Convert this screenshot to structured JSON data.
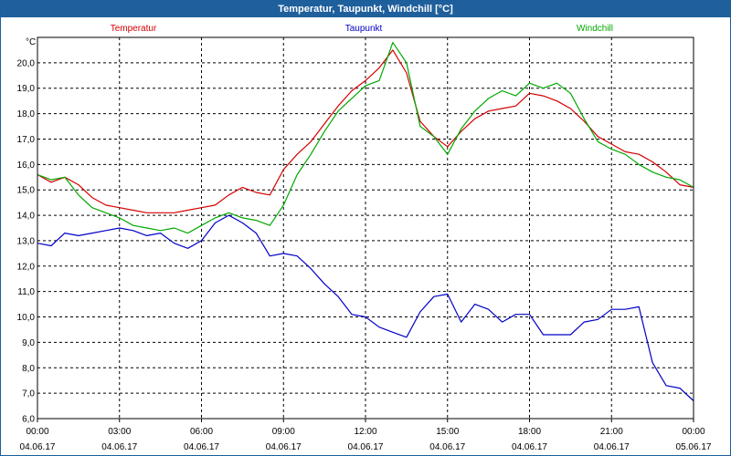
{
  "window": {
    "title": "Temperatur, Taupunkt, Windchill [°C]"
  },
  "colors": {
    "temperatur": "#d40000",
    "taupunkt": "#0000c8",
    "windchill": "#00a800",
    "grid": "#000000"
  },
  "chart_data": {
    "type": "line",
    "title": "Temperatur, Taupunkt, Windchill [°C]",
    "ylabel": "°C",
    "ylim": [
      6.0,
      21.0
    ],
    "y_ticks": [
      "6,0",
      "7,0",
      "8,0",
      "9,0",
      "10,0",
      "11,0",
      "12,0",
      "13,0",
      "14,0",
      "15,0",
      "16,0",
      "17,0",
      "18,0",
      "19,0",
      "20,0"
    ],
    "x_hours_range": [
      0,
      24
    ],
    "x_ticks": [
      {
        "time": "00:00",
        "date": "04.06.17"
      },
      {
        "time": "03:00",
        "date": "04.06.17"
      },
      {
        "time": "06:00",
        "date": "04.06.17"
      },
      {
        "time": "09:00",
        "date": "04.06.17"
      },
      {
        "time": "12:00",
        "date": "04.06.17"
      },
      {
        "time": "15:00",
        "date": "04.06.17"
      },
      {
        "time": "18:00",
        "date": "04.06.17"
      },
      {
        "time": "21:00",
        "date": "04.06.17"
      },
      {
        "time": "00:00",
        "date": "05.06.17"
      }
    ],
    "grid": true,
    "legend_placement": "top",
    "series": [
      {
        "name": "Temperatur",
        "color": "#d40000",
        "x": [
          0,
          0.5,
          1,
          1.5,
          2,
          2.5,
          3,
          3.5,
          4,
          4.5,
          5,
          5.5,
          6,
          6.5,
          7,
          7.5,
          8,
          8.5,
          9,
          9.5,
          10,
          10.5,
          11,
          11.5,
          12,
          12.5,
          13,
          13.5,
          14,
          14.5,
          15,
          15.5,
          16,
          16.5,
          17,
          17.5,
          18,
          18.5,
          19,
          19.5,
          20,
          20.5,
          21,
          21.5,
          22,
          22.5,
          23,
          23.5,
          24
        ],
        "values": [
          15.6,
          15.3,
          15.5,
          15.2,
          14.7,
          14.4,
          14.3,
          14.2,
          14.1,
          14.1,
          14.1,
          14.2,
          14.3,
          14.4,
          14.8,
          15.1,
          14.9,
          14.8,
          15.8,
          16.4,
          16.9,
          17.6,
          18.3,
          18.9,
          19.3,
          19.8,
          20.5,
          19.6,
          17.7,
          17.1,
          16.7,
          17.3,
          17.8,
          18.1,
          18.2,
          18.3,
          18.8,
          18.7,
          18.5,
          18.2,
          17.7,
          17.1,
          16.8,
          16.5,
          16.4,
          16.1,
          15.7,
          15.2,
          15.1
        ]
      },
      {
        "name": "Taupunkt",
        "color": "#0000c8",
        "x": [
          0,
          0.5,
          1,
          1.5,
          2,
          2.5,
          3,
          3.5,
          4,
          4.5,
          5,
          5.5,
          6,
          6.5,
          7,
          7.5,
          8,
          8.5,
          9,
          9.5,
          10,
          10.5,
          11,
          11.5,
          12,
          12.5,
          13,
          13.5,
          14,
          14.5,
          15,
          15.5,
          16,
          16.5,
          17,
          17.5,
          18,
          18.5,
          19,
          19.5,
          20,
          20.5,
          21,
          21.5,
          22,
          22.5,
          23,
          23.5,
          24
        ],
        "values": [
          12.9,
          12.8,
          13.3,
          13.2,
          13.3,
          13.4,
          13.5,
          13.4,
          13.2,
          13.3,
          12.9,
          12.7,
          13.0,
          13.7,
          14.0,
          13.7,
          13.3,
          12.4,
          12.5,
          12.4,
          11.9,
          11.3,
          10.8,
          10.1,
          10.0,
          9.6,
          9.4,
          9.2,
          10.2,
          10.8,
          10.9,
          9.8,
          10.5,
          10.3,
          9.8,
          10.1,
          10.1,
          9.3,
          9.3,
          9.3,
          9.8,
          9.9,
          10.3,
          10.3,
          10.4,
          8.2,
          7.3,
          7.2,
          6.7
        ]
      },
      {
        "name": "Windchill",
        "color": "#00a800",
        "x": [
          0,
          0.5,
          1,
          1.5,
          2,
          2.5,
          3,
          3.5,
          4,
          4.5,
          5,
          5.5,
          6,
          6.5,
          7,
          7.5,
          8,
          8.5,
          9,
          9.5,
          10,
          10.5,
          11,
          11.5,
          12,
          12.5,
          13,
          13.5,
          14,
          14.5,
          15,
          15.5,
          16,
          16.5,
          17,
          17.5,
          18,
          18.5,
          19,
          19.5,
          20,
          20.5,
          21,
          21.5,
          22,
          22.5,
          23,
          23.5,
          24
        ],
        "values": [
          15.6,
          15.4,
          15.5,
          14.8,
          14.3,
          14.1,
          13.9,
          13.6,
          13.5,
          13.4,
          13.5,
          13.3,
          13.6,
          13.9,
          14.1,
          13.9,
          13.8,
          13.6,
          14.4,
          15.6,
          16.4,
          17.3,
          18.1,
          18.6,
          19.1,
          19.3,
          20.8,
          20.0,
          17.5,
          17.1,
          16.4,
          17.4,
          18.1,
          18.6,
          18.9,
          18.7,
          19.2,
          19.0,
          19.2,
          18.8,
          17.8,
          16.9,
          16.6,
          16.4,
          16.0,
          15.7,
          15.5,
          15.4,
          15.1
        ]
      }
    ]
  }
}
